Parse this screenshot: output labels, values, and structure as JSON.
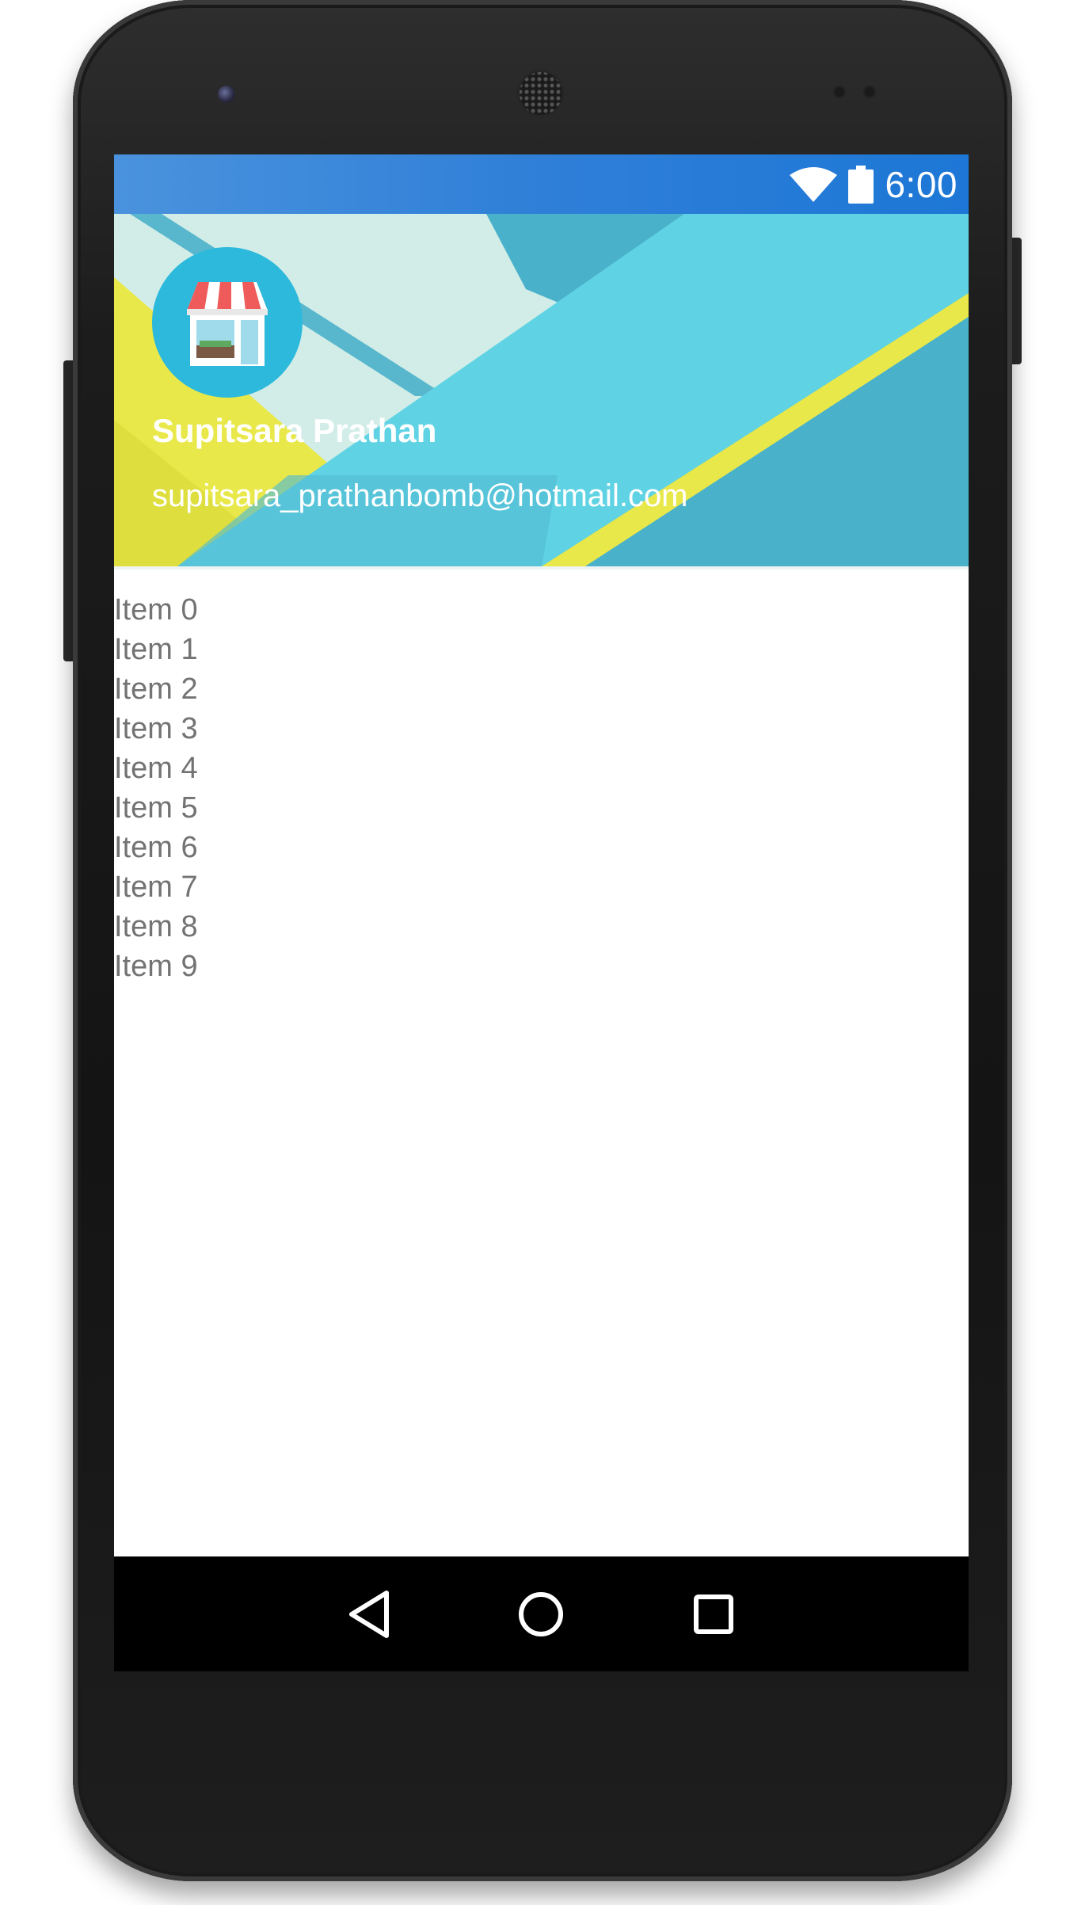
{
  "status_bar": {
    "time": "6:00",
    "icons": [
      "wifi-icon",
      "battery-icon"
    ],
    "color": "#1d77d6"
  },
  "drawer_header": {
    "avatar_icon": "storefront-icon",
    "user_name": "Supitsara Prathan",
    "user_email": "supitsara_prathanbomb@hotmail.com",
    "colors": {
      "teal": "#5fd3e4",
      "dark_teal": "#4ab1cb",
      "mint": "#d2ede8",
      "yellow": "#e9e84a"
    }
  },
  "list": {
    "items": [
      "Item 0",
      "Item 1",
      "Item 2",
      "Item 3",
      "Item 4",
      "Item 5",
      "Item 6",
      "Item 7",
      "Item 8",
      "Item 9"
    ]
  },
  "nav_bar": {
    "buttons": [
      "back-icon",
      "home-icon",
      "recent-apps-icon"
    ]
  }
}
